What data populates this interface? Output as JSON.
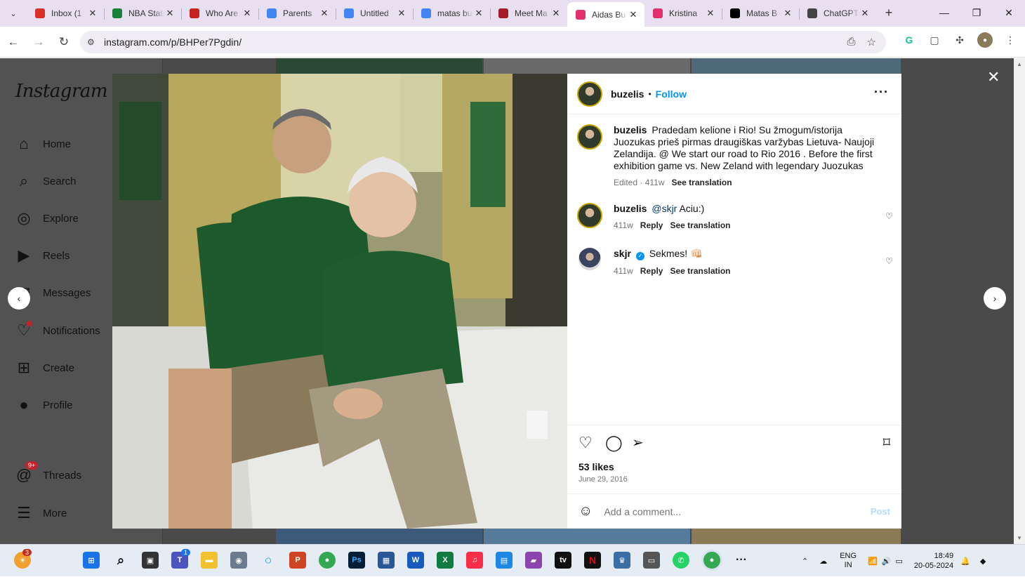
{
  "browser": {
    "tabs": [
      {
        "title": "Inbox (1",
        "icon": "gmail-icon",
        "color": "#d93025",
        "active": false
      },
      {
        "title": "NBA Stats",
        "icon": "sheets-icon",
        "color": "#188038",
        "active": false
      },
      {
        "title": "Who Are",
        "icon": "news-icon",
        "color": "#c5221f",
        "active": false
      },
      {
        "title": "Parents",
        "icon": "docs-icon",
        "color": "#4285f4",
        "active": false
      },
      {
        "title": "Untitled",
        "icon": "docs-icon",
        "color": "#4285f4",
        "active": false
      },
      {
        "title": "matas bu",
        "icon": "google-icon",
        "color": "#4285f4",
        "active": false
      },
      {
        "title": "Meet Ma",
        "icon": "star-site-icon",
        "color": "#a61b29",
        "active": false
      },
      {
        "title": "Aidas Bu",
        "icon": "instagram-icon",
        "color": "#e1306c",
        "active": true
      },
      {
        "title": "Kristina",
        "icon": "instagram-icon",
        "color": "#e1306c",
        "active": false
      },
      {
        "title": "Matas B",
        "icon": "wikipedia-icon",
        "color": "#000000",
        "active": false
      },
      {
        "title": "ChatGPT",
        "icon": "chatgpt-icon",
        "color": "#444444",
        "active": false
      }
    ],
    "url": "instagram.com/p/BHPer7Pgdin/"
  },
  "sidebar": {
    "logo": "Instagram",
    "items": [
      {
        "label": "Home",
        "icon": "home-icon"
      },
      {
        "label": "Search",
        "icon": "search-icon"
      },
      {
        "label": "Explore",
        "icon": "compass-icon"
      },
      {
        "label": "Reels",
        "icon": "reels-icon"
      },
      {
        "label": "Messages",
        "icon": "messenger-icon"
      },
      {
        "label": "Notifications",
        "icon": "heart-icon"
      },
      {
        "label": "Create",
        "icon": "plus-square-icon"
      },
      {
        "label": "Profile",
        "icon": "avatar-icon"
      },
      {
        "label": "Threads",
        "icon": "threads-icon",
        "badge": "9+"
      },
      {
        "label": "More",
        "icon": "hamburger-icon"
      }
    ]
  },
  "post": {
    "header": {
      "username": "buzelis",
      "follow": "Follow"
    },
    "caption": {
      "username": "buzelis",
      "text": "Pradedam kelione i Rio! Su žmogum/istorija Juozukas prieš pirmas draugiškas varžybas Lietuva- Naujoji Zelandija. @ We start our road to Rio 2016 . Before the first exhibition game vs. New Zeland with legendary Juozukas",
      "edited": "Edited",
      "age": "411w",
      "see_translation": "See translation"
    },
    "comments": [
      {
        "username": "buzelis",
        "mention": "@skjr",
        "text": "Aciu:)",
        "age": "411w",
        "reply": "Reply",
        "see_translation": "See translation",
        "verified": false
      },
      {
        "username": "skjr",
        "mention": "",
        "text": "Sekmes! 👊🏻",
        "age": "411w",
        "reply": "Reply",
        "see_translation": "See translation",
        "verified": true
      }
    ],
    "likes": "53 likes",
    "date": "June 29, 2016",
    "add_comment_placeholder": "Add a comment...",
    "post_label": "Post"
  },
  "taskbar": {
    "notif_badge": "3",
    "teams_badge": "1",
    "lang_top": "ENG",
    "lang_bottom": "IN",
    "time": "18:49",
    "date": "20-05-2024"
  },
  "colors": {
    "accent": "#0095f6",
    "overlay": "#4a4a4a",
    "tabstrip": "#e8e0f0"
  }
}
